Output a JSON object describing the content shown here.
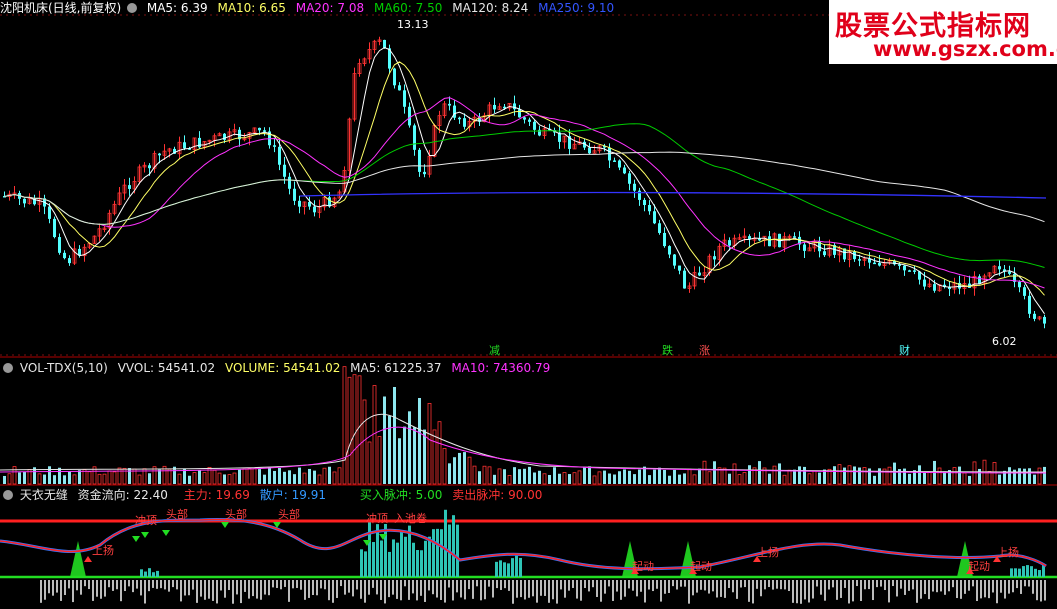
{
  "colors": {
    "background": "#000000",
    "candle_up": "#ff3333",
    "candle_down": "#54ffff",
    "ma5": "#ffffff",
    "ma10": "#ffff66",
    "ma20": "#ff33ff",
    "ma60": "#00cc00",
    "ma120": "#e6e6e6",
    "ma250": "#3333ff",
    "separator": "#b00000",
    "signal_red": "#ff2020",
    "signal_green": "#22dd22",
    "signal_teal": "#2ec4b6"
  },
  "main": {
    "stock": "沈阳机床(日线,前复权)",
    "ma": [
      {
        "label": "MA5:",
        "value": "6.39"
      },
      {
        "label": "MA10:",
        "value": "6.65"
      },
      {
        "label": "MA20:",
        "value": "7.08"
      },
      {
        "label": "MA60:",
        "value": "7.50"
      },
      {
        "label": "MA120:",
        "value": "8.24"
      },
      {
        "label": "MA250:",
        "value": "9.10"
      }
    ],
    "high_label": "13.13",
    "low_label": "6.02",
    "markers": [
      "减",
      "跌",
      "涨",
      "财"
    ]
  },
  "volume": {
    "name": "VOL-TDX(5,10)",
    "vvol": "VVOL: 54541.02",
    "volume": "VOLUME: 54541.02",
    "ma5": "MA5: 61225.37",
    "ma10": "MA10: 74360.79"
  },
  "indicator": {
    "name": "天衣无缝",
    "flow": "资金流向: 22.40",
    "main": "主力: 19.69",
    "retail": "散户: 19.91",
    "buy": "买入脉冲: 5.00",
    "sell": "卖出脉冲: 90.00",
    "labels": [
      "上扬",
      "冲顶",
      "头部",
      "头部",
      "头部",
      "冲顶",
      "入池卷",
      "起动",
      "起动",
      "上扬",
      "起动",
      "上扬"
    ]
  },
  "watermark": {
    "title": "股票公式指标网",
    "url": "www.gszx.com.cn"
  }
}
